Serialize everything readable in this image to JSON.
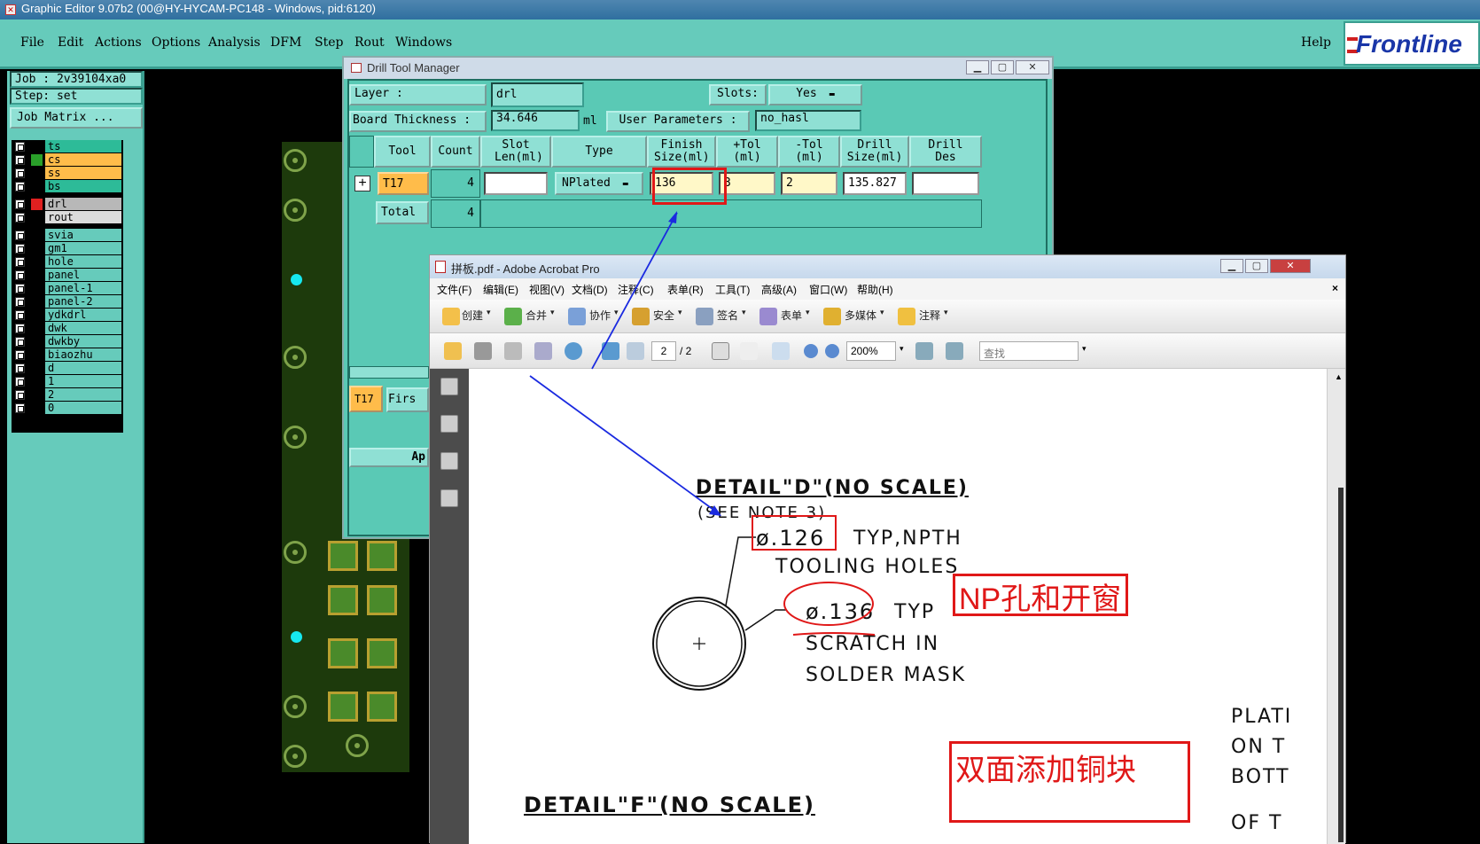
{
  "app": {
    "title": "Graphic Editor 9.07b2 (00@HY-HYCAM-PC148 - Windows, pid:6120)",
    "menu": [
      "File",
      "Edit",
      "Actions",
      "Options",
      "Analysis",
      "DFM",
      "Step",
      "Rout",
      "Windows"
    ],
    "help": "Help",
    "logo": "Frontline"
  },
  "left_panel": {
    "job": "Job : 2v39104xa0",
    "step": "Step: set",
    "job_matrix": "Job Matrix ...",
    "layers_top": [
      {
        "name": "ts",
        "swatch": "#000000",
        "bg": "#2dbb98"
      },
      {
        "name": "cs",
        "swatch": "#2aa02a",
        "bg": "#ffbc4a"
      },
      {
        "name": "ss",
        "swatch": "#000000",
        "bg": "#ffbc4a"
      },
      {
        "name": "bs",
        "swatch": "#000000",
        "bg": "#2dbb98"
      }
    ],
    "layers_drill": [
      {
        "name": "drl",
        "swatch": "#e02020",
        "bg": "#b8b8b8"
      },
      {
        "name": "rout",
        "swatch": "#000000",
        "bg": "#dcdcdc"
      }
    ],
    "layers_other": [
      "svia",
      "gm1",
      "hole",
      "panel",
      "panel-1",
      "panel-2",
      "ydkdrl",
      "dwk",
      "dwkby",
      "biaozhu",
      "d",
      "1",
      "2",
      "0"
    ]
  },
  "drill_tool_manager": {
    "title": "Drill Tool Manager",
    "layer_label": "Layer :",
    "layer_value": "drl",
    "slots_label": "Slots:",
    "slots_value": "Yes",
    "board_thickness_label": "Board Thickness :",
    "board_thickness_value": "34.646",
    "board_thickness_unit": "ml",
    "user_params_label": "User Parameters :",
    "user_params_value": "no_hasl",
    "columns": [
      "Tool",
      "Count",
      "Slot Len(ml)",
      "Type",
      "Finish Size(ml)",
      "+Tol (ml)",
      "-Tol (ml)",
      "Drill Size(ml)",
      "Drill Des"
    ],
    "row": {
      "tool": "T17",
      "count": "4",
      "slot_len": "",
      "type": "NPlated",
      "finish_size": "136",
      "plus_tol": "3",
      "minus_tol": "2",
      "drill_size": "135.827",
      "drill_des": ""
    },
    "total": {
      "label": "Total",
      "count": "4"
    },
    "bottom_tool": "T17",
    "bottom_field": "Firs",
    "apply_fragment": "Ap"
  },
  "acrobat": {
    "title": "拼板.pdf - Adobe Acrobat Pro",
    "menu": [
      "文件(F)",
      "编辑(E)",
      "视图(V)",
      "文档(D)",
      "注释(C)",
      "表单(R)",
      "工具(T)",
      "高级(A)",
      "窗口(W)",
      "帮助(H)"
    ],
    "toolbar": [
      "创建",
      "合并",
      "协作",
      "安全",
      "签名",
      "表单",
      "多媒体",
      "注释"
    ],
    "page_current": "2",
    "page_total": "/ 2",
    "zoom": "200%",
    "search_placeholder": "查找",
    "drawing": {
      "detail_d": "DETAIL\"D\"(NO SCALE)",
      "see_note": "(SEE NOTE 3)",
      "dia_126": "ø.126",
      "typ_npth": "TYP,NPTH",
      "tooling_holes": "TOOLING HOLES",
      "dia_136": "ø.136",
      "typ": "TYP",
      "scratch": "SCRATCH IN",
      "solder_mask": "SOLDER MASK",
      "detail_f": "DETAIL\"F\"(NO SCALE)",
      "right_col": [
        "PLATI",
        "ON T",
        "BOTT",
        "OF T"
      ]
    },
    "annotations": {
      "np": "NP孔和开窗",
      "copper": "双面添加铜块"
    }
  }
}
